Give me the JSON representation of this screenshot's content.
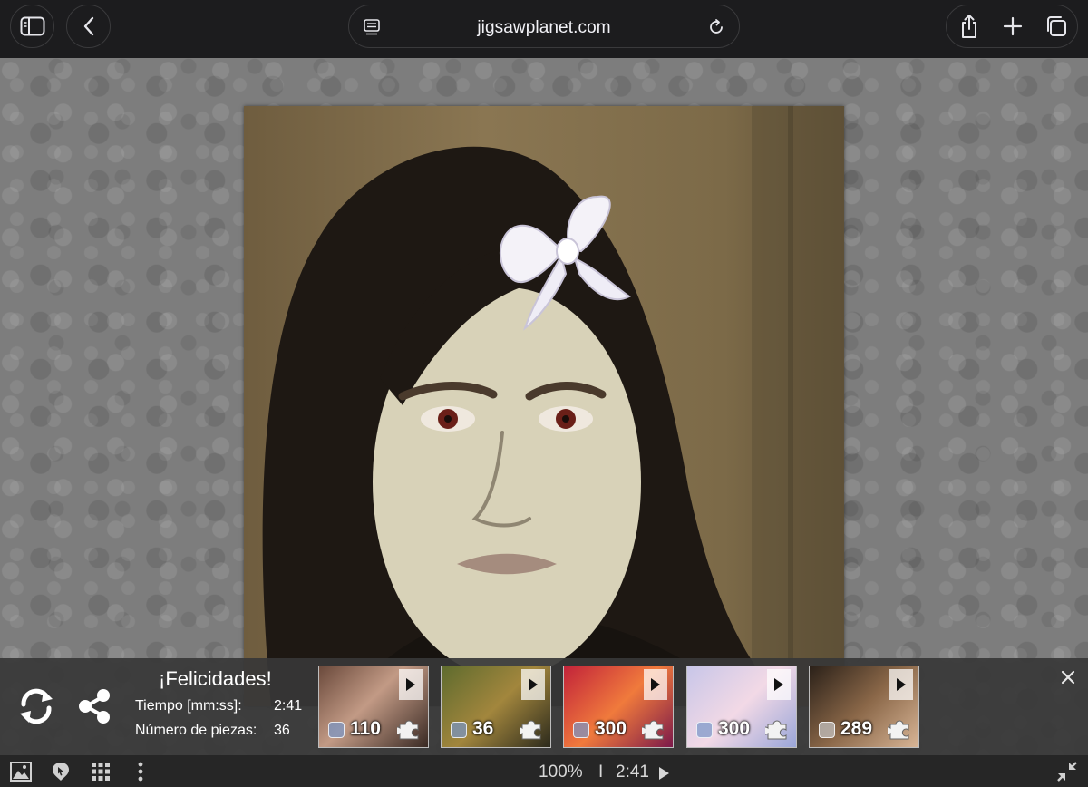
{
  "browser": {
    "url": "jigsawplanet.com",
    "icons": {
      "sidebar": "sidebar-icon",
      "back": "chevron-left-icon",
      "reader": "reader-icon",
      "reload": "reload-icon",
      "share": "share-icon",
      "new_tab": "plus-icon",
      "tabs": "tabs-icon"
    }
  },
  "congrats": {
    "title": "¡Felicidades!",
    "time_label": "Tiempo [mm:ss]:",
    "time_value": "2:41",
    "pieces_label": "Número de piezas:",
    "pieces_value": "36",
    "icons": {
      "restart": "refresh-icon",
      "share": "share-nodes-icon",
      "close": "close-icon"
    }
  },
  "suggestions": [
    {
      "count": "110",
      "colors": [
        "#6b4a3c",
        "#c29a85",
        "#3a2a24"
      ]
    },
    {
      "count": "36",
      "colors": [
        "#5e6b2e",
        "#a2863d",
        "#2c2a1c"
      ]
    },
    {
      "count": "300",
      "colors": [
        "#c2233a",
        "#f07a3c",
        "#7c1a4a"
      ]
    },
    {
      "count": "300",
      "colors": [
        "#c8c6e8",
        "#f2d9e6",
        "#9aa6d8"
      ]
    },
    {
      "count": "289",
      "colors": [
        "#2b2119",
        "#8a6748",
        "#d8b596"
      ]
    }
  ],
  "statusbar": {
    "zoom": "100%",
    "separator": "I",
    "time": "2:41",
    "icons": [
      "image-icon",
      "cursor-pin-icon",
      "grid-icon",
      "more-vertical-icon",
      "collapse-icon"
    ]
  }
}
